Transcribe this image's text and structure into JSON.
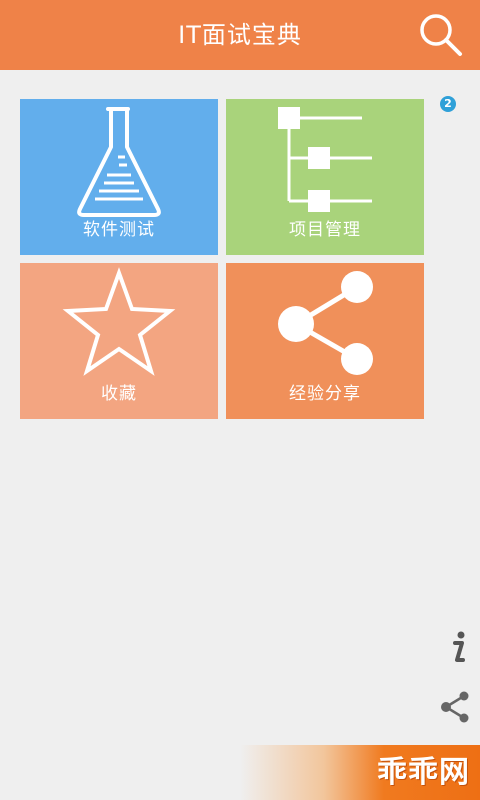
{
  "app": {
    "title": "IT面试宝典",
    "badge": "2"
  },
  "tiles": [
    {
      "label": "软件测试",
      "icon": "flask-icon",
      "color": "#62aeec"
    },
    {
      "label": "项目管理",
      "icon": "tree-structure-icon",
      "color": "#a9d37b"
    },
    {
      "label": "收藏",
      "icon": "star-icon",
      "color": "#f3a581"
    },
    {
      "label": "经验分享",
      "icon": "share-icon",
      "color": "#f0905a"
    }
  ],
  "side_actions": [
    {
      "icon": "info-icon"
    },
    {
      "icon": "share-icon"
    }
  ],
  "watermark": {
    "text": "乖乖网"
  },
  "colors": {
    "appbar": "#ef8248",
    "background": "#efefef"
  }
}
